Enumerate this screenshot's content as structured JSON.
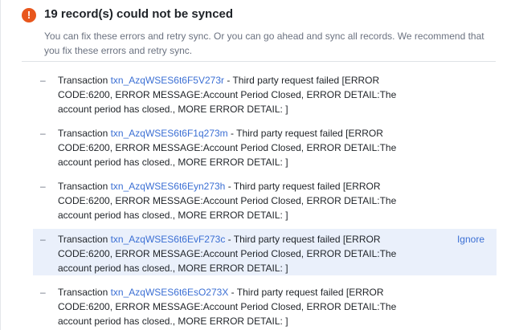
{
  "header": {
    "icon": "warning-icon",
    "icon_glyph": "!",
    "accent_color": "#e8561c",
    "title": "19 record(s) could not be synced",
    "subtitle": "You can fix these errors and retry sync. Or you can go ahead and sync all records. We recommend that you fix these errors and retry sync."
  },
  "colors": {
    "link": "#3b6fd4",
    "highlight_row": "#eaf0fb"
  },
  "errors": [
    {
      "dash": "–",
      "prefix": "Transaction ",
      "txn_id": "txn_AzqWSES6t6F5V273r",
      "message": " - Third party request failed [ERROR CODE:6200, ERROR MESSAGE:Account Period Closed, ERROR DETAIL:The account period has closed., MORE ERROR DETAIL: ]",
      "highlighted": false,
      "ignore_label": ""
    },
    {
      "dash": "–",
      "prefix": "Transaction ",
      "txn_id": "txn_AzqWSES6t6F1q273m",
      "message": " - Third party request failed [ERROR CODE:6200, ERROR MESSAGE:Account Period Closed, ERROR DETAIL:The account period has closed., MORE ERROR DETAIL: ]",
      "highlighted": false,
      "ignore_label": ""
    },
    {
      "dash": "–",
      "prefix": "Transaction ",
      "txn_id": "txn_AzqWSES6t6Eyn273h",
      "message": " - Third party request failed [ERROR CODE:6200, ERROR MESSAGE:Account Period Closed, ERROR DETAIL:The account period has closed., MORE ERROR DETAIL: ]",
      "highlighted": false,
      "ignore_label": ""
    },
    {
      "dash": "–",
      "prefix": "Transaction ",
      "txn_id": "txn_AzqWSES6t6EvF273c",
      "message": " - Third party request failed [ERROR CODE:6200, ERROR MESSAGE:Account Period Closed, ERROR DETAIL:The account period has closed., MORE ERROR DETAIL: ]",
      "highlighted": true,
      "ignore_label": "Ignore"
    },
    {
      "dash": "–",
      "prefix": "Transaction ",
      "txn_id": "txn_AzqWSES6t6EsO273X",
      "message": " - Third party request failed [ERROR CODE:6200, ERROR MESSAGE:Account Period Closed, ERROR DETAIL:The account period has closed., MORE ERROR DETAIL: ]",
      "highlighted": false,
      "ignore_label": ""
    }
  ]
}
